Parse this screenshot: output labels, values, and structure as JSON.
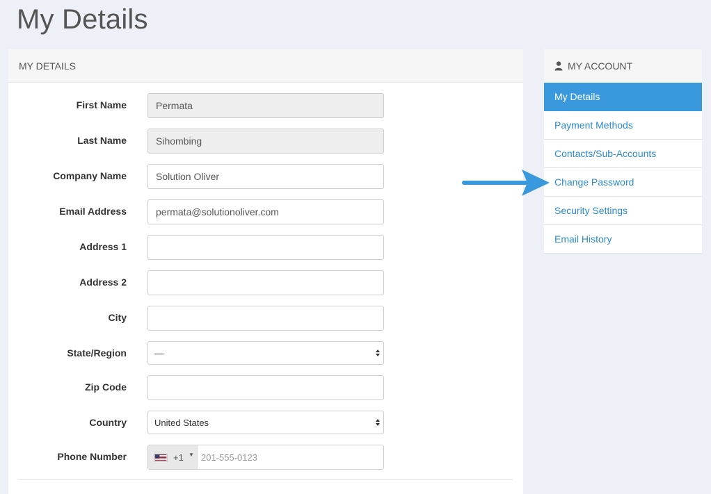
{
  "page": {
    "title": "My Details"
  },
  "panel": {
    "header": "MY DETAILS",
    "fields": {
      "first_name": {
        "label": "First Name",
        "value": "Permata"
      },
      "last_name": {
        "label": "Last Name",
        "value": "Sihombing"
      },
      "company_name": {
        "label": "Company Name",
        "value": "Solution Oliver"
      },
      "email": {
        "label": "Email Address",
        "value": "permata@solutionoliver.com"
      },
      "address1": {
        "label": "Address 1",
        "value": ""
      },
      "address2": {
        "label": "Address 2",
        "value": ""
      },
      "city": {
        "label": "City",
        "value": ""
      },
      "state": {
        "label": "State/Region",
        "value": "—"
      },
      "zip": {
        "label": "Zip Code",
        "value": ""
      },
      "country": {
        "label": "Country",
        "value": "United States"
      },
      "phone": {
        "label": "Phone Number",
        "dial_code": "+1",
        "placeholder": "201-555-0123"
      }
    }
  },
  "sidebar": {
    "header": "MY ACCOUNT",
    "items": [
      {
        "label": "My Details",
        "active": true
      },
      {
        "label": "Payment Methods"
      },
      {
        "label": "Contacts/Sub-Accounts"
      },
      {
        "label": "Change Password"
      },
      {
        "label": "Security Settings"
      },
      {
        "label": "Email History"
      }
    ]
  },
  "colors": {
    "background": "#eef0f7",
    "accent": "#3a99dd",
    "link": "#2b8bd0",
    "arrow": "#3a99dd"
  },
  "icons": {
    "sidebar_header": "user-icon",
    "annotation": "arrow-right-icon"
  }
}
